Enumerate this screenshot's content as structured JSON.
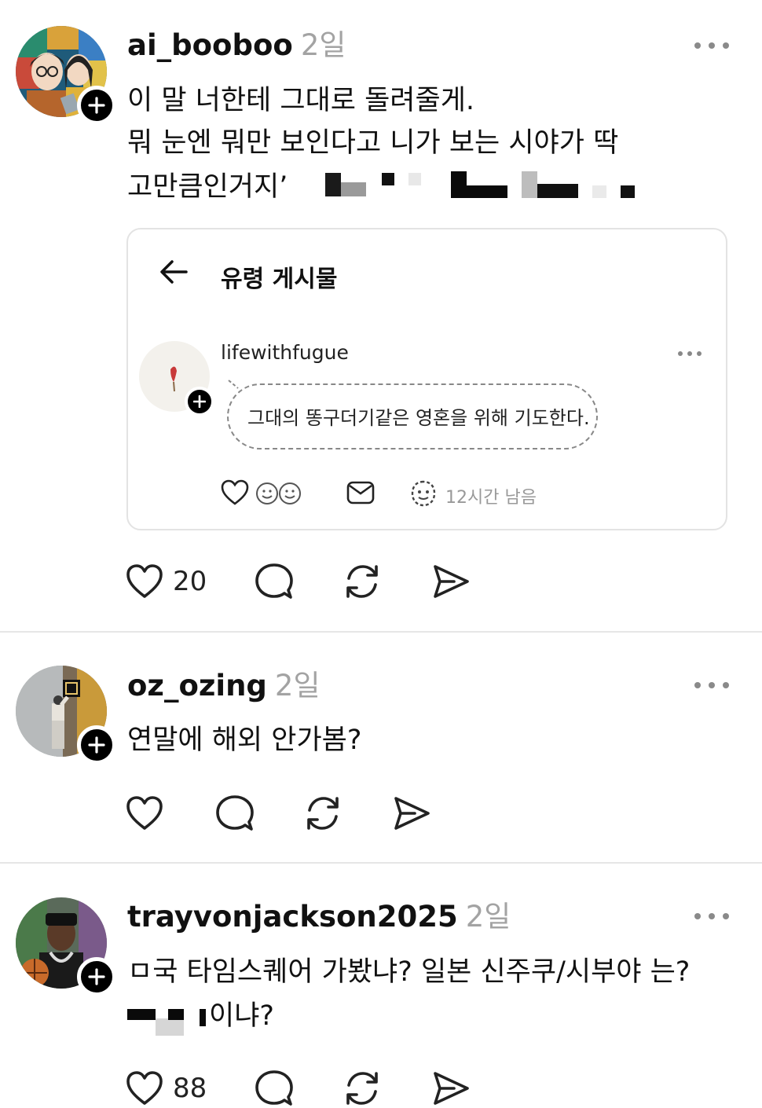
{
  "posts": [
    {
      "username": "ai_booboo",
      "time": "2일",
      "lines": [
        "이 말 너한테 그대로 돌려줄게.",
        "뭐 눈엔 뭐만 보인다고 니가 보는 시야가 딱",
        "고만큼인거지’"
      ],
      "likes": "20",
      "embed": {
        "title": "유령 게시물",
        "username": "lifewithfugue",
        "text": "그대의 똥구더기같은 영혼을 위해 기도한다.",
        "remaining": "12시간 남음"
      }
    },
    {
      "username": "oz_ozing",
      "time": "2일",
      "lines": [
        "연말에 해외 안가봄?"
      ],
      "likes": ""
    },
    {
      "username": "trayvonjackson2025",
      "time": "2일",
      "lines": [
        "ㅁ국 타임스퀘어 가봤냐? 일본 신주쿠/시부야 는?",
        "이냐?"
      ],
      "likes": "88"
    }
  ],
  "icons": [
    "plus-icon",
    "more-icon",
    "heart-icon",
    "comment-icon",
    "repost-icon",
    "share-icon",
    "back-arrow-icon",
    "emoji-icon",
    "mail-icon",
    "ghost-icon"
  ],
  "colors": {
    "text": "#111111",
    "muted": "#a3a3a3",
    "divider": "#e6e6e6",
    "badge": "#000000"
  }
}
